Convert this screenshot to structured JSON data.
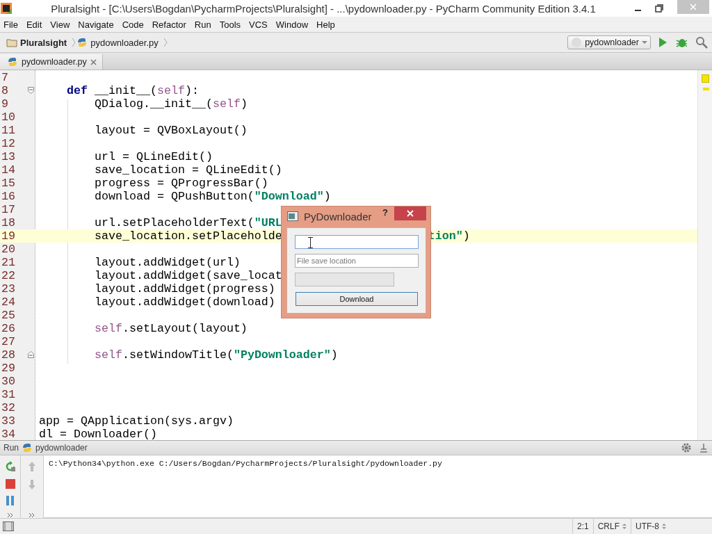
{
  "window": {
    "title": "Pluralsight - [C:\\Users\\Bogdan\\PycharmProjects\\Pluralsight] - ...\\pydownloader.py - PyCharm Community Edition 3.4.1"
  },
  "menu": [
    "File",
    "Edit",
    "View",
    "Navigate",
    "Code",
    "Refactor",
    "Run",
    "Tools",
    "VCS",
    "Window",
    "Help"
  ],
  "breadcrumbs": [
    {
      "label": "Pluralsight",
      "kind": "folder"
    },
    {
      "label": "pydownloader.py",
      "kind": "file"
    }
  ],
  "run_config": {
    "label": "pydownloader"
  },
  "tabs": [
    {
      "label": "pydownloader.py",
      "selected": true
    }
  ],
  "editor": {
    "lines": [
      {
        "number": "7",
        "current": false
      },
      {
        "number": "8",
        "current": false,
        "fold": {
          "kind": "start"
        },
        "segments": [
          {
            "t": "    def",
            "kind": "keyword"
          },
          {
            "t": " __init__(",
            "kind": "plain"
          },
          {
            "t": "self",
            "kind": "self"
          },
          {
            "t": "):",
            "kind": "plain"
          }
        ]
      },
      {
        "number": "9",
        "current": false,
        "segments": [
          {
            "t": "        QDialog.__init__(",
            "kind": "plain"
          },
          {
            "t": "self",
            "kind": "self"
          },
          {
            "t": ")",
            "kind": "plain"
          }
        ]
      },
      {
        "number": "10",
        "current": false
      },
      {
        "number": "11",
        "current": false,
        "segments": [
          {
            "t": "        layout = QVBoxLayout()",
            "kind": "plain"
          }
        ]
      },
      {
        "number": "12",
        "current": false
      },
      {
        "number": "13",
        "current": false,
        "segments": [
          {
            "t": "        url = QLineEdit()",
            "kind": "plain"
          }
        ]
      },
      {
        "number": "14",
        "current": false,
        "segments": [
          {
            "t": "        save_location = QLineEdit()",
            "kind": "plain"
          }
        ]
      },
      {
        "number": "15",
        "current": false,
        "segments": [
          {
            "t": "        progress = QProgressBar()",
            "kind": "plain"
          }
        ]
      },
      {
        "number": "16",
        "current": false,
        "segments": [
          {
            "t": "        download = QPushButton(",
            "kind": "plain"
          },
          {
            "t": "\"Download\"",
            "kind": "string"
          },
          {
            "t": ")",
            "kind": "plain"
          }
        ]
      },
      {
        "number": "17",
        "current": false
      },
      {
        "number": "18",
        "current": false,
        "segments": [
          {
            "t": "        url.setPlaceholderText(",
            "kind": "plain"
          },
          {
            "t": "\"URL",
            "kind": "string"
          }
        ]
      },
      {
        "number": "19",
        "current": true,
        "segments": [
          {
            "t": "        save_location.setPlaceholde",
            "kind": "plain"
          }
        ],
        "resume": [
          {
            "t": "tion\"",
            "kind": "string"
          },
          {
            "t": ")",
            "kind": "plain"
          }
        ]
      },
      {
        "number": "20",
        "current": false
      },
      {
        "number": "21",
        "current": false,
        "segments": [
          {
            "t": "        layout.addWidget(url)",
            "kind": "plain"
          }
        ]
      },
      {
        "number": "22",
        "current": false,
        "segments": [
          {
            "t": "        layout.addWidget(save_locat",
            "kind": "plain"
          }
        ]
      },
      {
        "number": "23",
        "current": false,
        "segments": [
          {
            "t": "        layout.addWidget(progress)",
            "kind": "plain"
          }
        ]
      },
      {
        "number": "24",
        "current": false,
        "segments": [
          {
            "t": "        layout.addWidget(download)",
            "kind": "plain"
          }
        ]
      },
      {
        "number": "25",
        "current": false
      },
      {
        "number": "26",
        "current": false,
        "segments": [
          {
            "t": "        self",
            "kind": "self"
          },
          {
            "t": ".setLayout(layout)",
            "kind": "plain"
          }
        ]
      },
      {
        "number": "27",
        "current": false
      },
      {
        "number": "28",
        "current": false,
        "fold": {
          "kind": "end"
        },
        "segments": [
          {
            "t": "        self",
            "kind": "self"
          },
          {
            "t": ".setWindowTitle(",
            "kind": "plain"
          },
          {
            "t": "\"PyDownloader\"",
            "kind": "string"
          },
          {
            "t": ")",
            "kind": "plain"
          }
        ]
      },
      {
        "number": "29",
        "current": false
      },
      {
        "number": "30",
        "current": false
      },
      {
        "number": "31",
        "current": false
      },
      {
        "number": "32",
        "current": false
      },
      {
        "number": "33",
        "current": false,
        "segments": [
          {
            "t": "app = QApplication(sys.argv)",
            "kind": "plain"
          }
        ]
      },
      {
        "number": "34",
        "current": false,
        "segments": [
          {
            "t": "dl = Downloader()",
            "kind": "plain"
          }
        ]
      }
    ]
  },
  "dialog": {
    "title": "PyDownloader",
    "help": "?",
    "controls": [
      {
        "kind": "field",
        "focused": true
      },
      {
        "kind": "field",
        "placeholder": "File save location",
        "focused": false
      },
      {
        "kind": "progress",
        "level": 0
      },
      {
        "kind": "button",
        "label": "Download"
      }
    ]
  },
  "run_panel": {
    "title": "Run",
    "config": "pydownloader",
    "output": [
      "C:\\Python34\\python.exe C:/Users/Bogdan/PycharmProjects/Pluralsight/pydownloader.py"
    ]
  },
  "status_bar": {
    "position": "2:1",
    "line_separator": "CRLF",
    "encoding": "UTF-8"
  }
}
